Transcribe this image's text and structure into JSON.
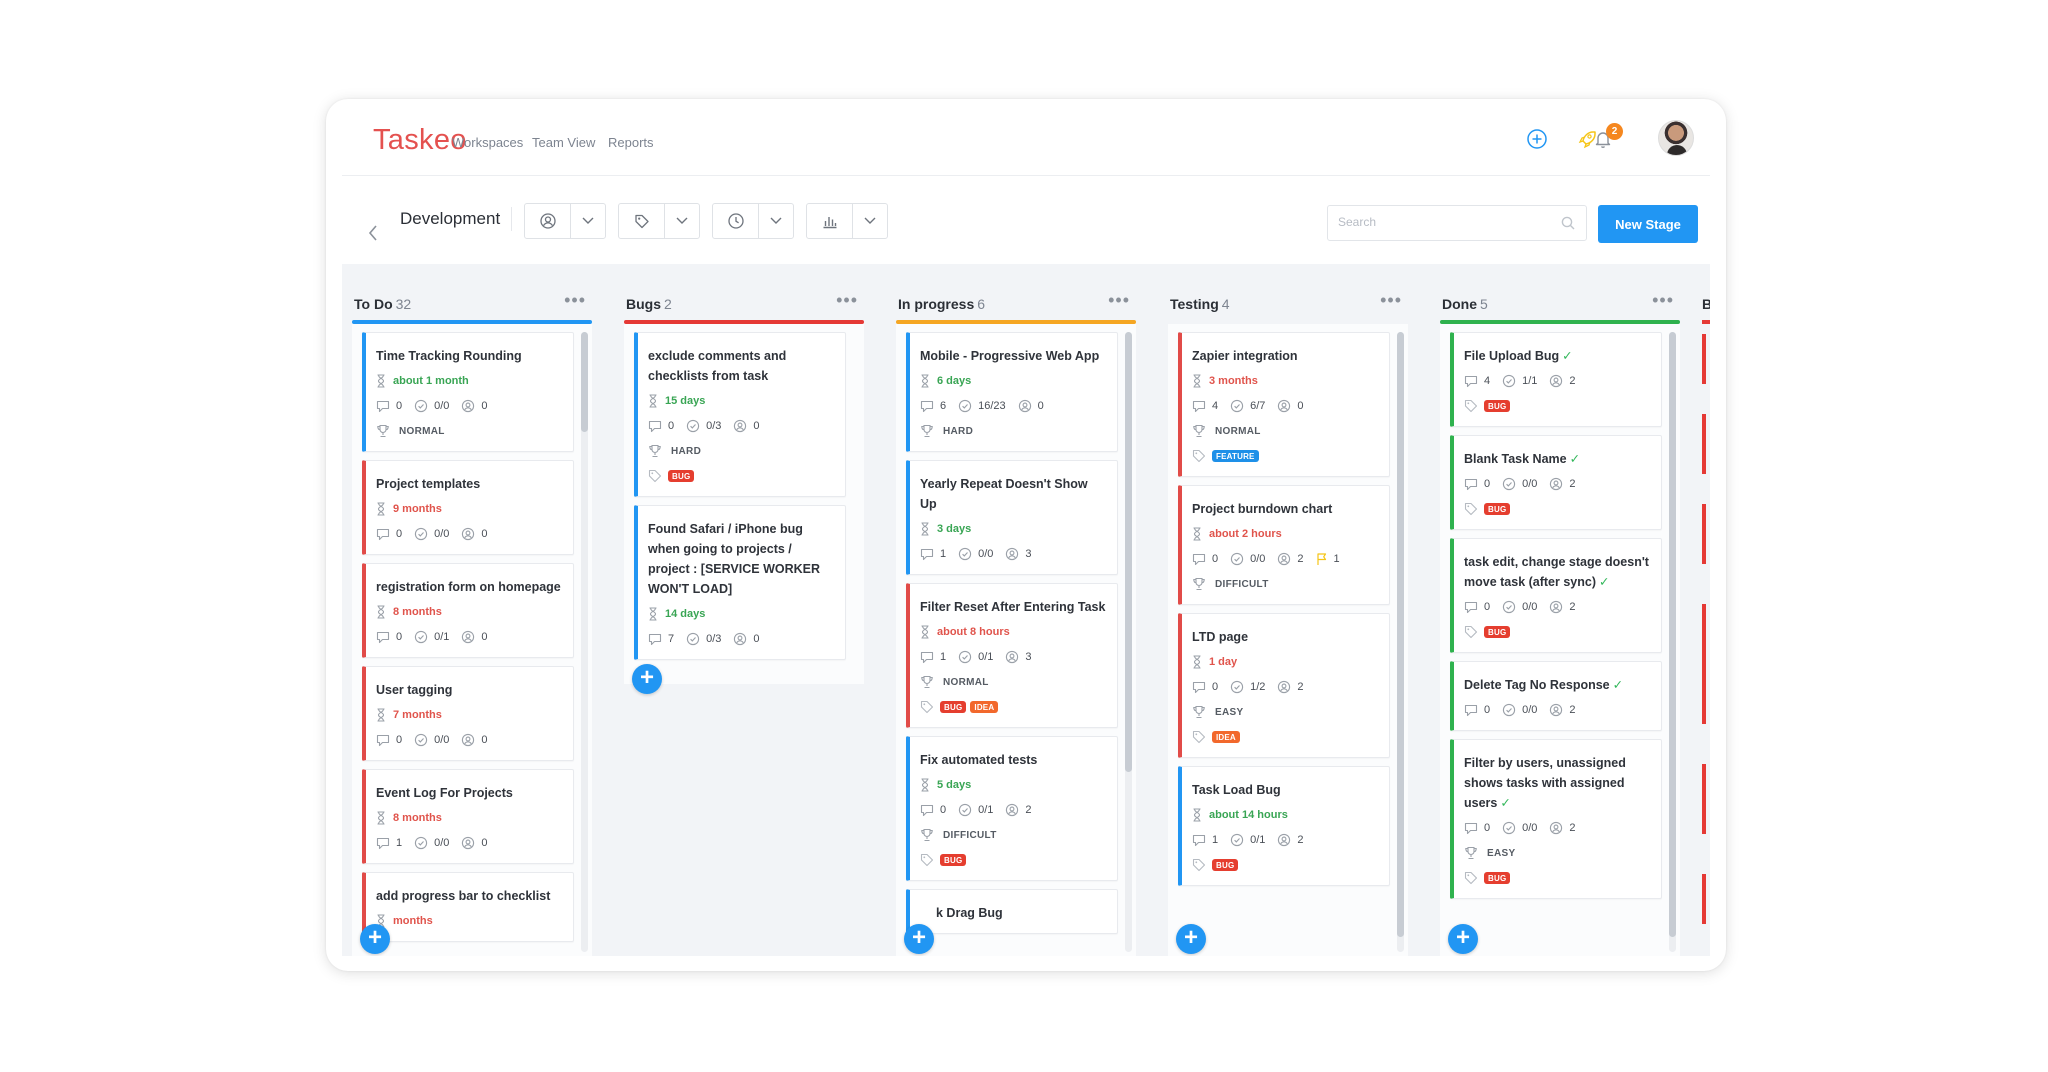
{
  "app": {
    "name": "Taskeo"
  },
  "nav": [
    "Workspaces",
    "Team View",
    "Reports"
  ],
  "notifications": {
    "count": "2"
  },
  "toolbar": {
    "board_title": "Development",
    "search_placeholder": "Search",
    "new_stage_label": "New Stage"
  },
  "colors": {
    "accent": "#2196f3",
    "logo": "#e4514f",
    "bug": "#e53e2f",
    "idea": "#f2682c",
    "feature": "#1e90e8",
    "done_check": "#32b75a"
  },
  "columns": [
    {
      "name": "To Do",
      "count": "32",
      "color": "#2196f3"
    },
    {
      "name": "Bugs",
      "count": "2",
      "color": "#e53935"
    },
    {
      "name": "In progress",
      "count": "6",
      "color": "#f5a623"
    },
    {
      "name": "Testing",
      "count": "4",
      "color": "#f2f4f7"
    },
    {
      "name": "Done",
      "count": "5",
      "color": "#2fb24e"
    },
    {
      "name": "Ba",
      "count": "",
      "color": "#e53935"
    }
  ],
  "todo": [
    {
      "title": "Time Tracking Rounding",
      "due": "about 1 month",
      "comments": "0",
      "checklist": "0/0",
      "users": "0",
      "difficulty": "NORMAL"
    },
    {
      "title": "Project templates",
      "due": "9 months",
      "comments": "0",
      "checklist": "0/0",
      "users": "0"
    },
    {
      "title": "registration form on homepage",
      "due": "8 months",
      "comments": "0",
      "checklist": "0/1",
      "users": "0"
    },
    {
      "title": "User tagging",
      "due": "7 months",
      "comments": "0",
      "checklist": "0/0",
      "users": "0"
    },
    {
      "title": "Event Log For Projects",
      "due": "8 months",
      "comments": "1",
      "checklist": "0/0",
      "users": "0"
    },
    {
      "title": "add progress bar to checklist",
      "due": "months"
    }
  ],
  "bugs": [
    {
      "title": "exclude comments and checklists from task",
      "due": "15 days",
      "comments": "0",
      "checklist": "0/3",
      "users": "0",
      "difficulty": "HARD",
      "tags": [
        "BUG"
      ]
    },
    {
      "title": "Found Safari / iPhone bug when going to projects / project : [SERVICE WORKER WON'T LOAD]",
      "due": "14 days",
      "comments": "7",
      "checklist": "0/3",
      "users": "0"
    }
  ],
  "in_progress": [
    {
      "title": "Mobile - Progressive Web App",
      "due": "6 days",
      "comments": "6",
      "checklist": "16/23",
      "users": "0",
      "difficulty": "HARD"
    },
    {
      "title": "Yearly Repeat Doesn't Show Up",
      "due": "3 days",
      "comments": "1",
      "checklist": "0/0",
      "users": "3"
    },
    {
      "title": "Filter Reset After Entering Task",
      "due": "about 8 hours",
      "comments": "1",
      "checklist": "0/1",
      "users": "3",
      "difficulty": "NORMAL",
      "tags": [
        "BUG",
        "IDEA"
      ]
    },
    {
      "title": "Fix automated tests",
      "due": "5 days",
      "comments": "0",
      "checklist": "0/1",
      "users": "2",
      "difficulty": "DIFFICULT",
      "tags": [
        "BUG"
      ]
    },
    {
      "title": "k Drag Bug"
    }
  ],
  "testing": [
    {
      "title": "Zapier integration",
      "due": "3 months",
      "comments": "4",
      "checklist": "6/7",
      "users": "0",
      "difficulty": "NORMAL",
      "tags": [
        "FEATURE"
      ]
    },
    {
      "title": "Project burndown chart",
      "due": "about 2 hours",
      "comments": "0",
      "checklist": "0/0",
      "users": "2",
      "flags": "1",
      "difficulty": "DIFFICULT"
    },
    {
      "title": "LTD page",
      "due": "1 day",
      "comments": "0",
      "checklist": "1/2",
      "users": "2",
      "difficulty": "EASY",
      "tags": [
        "IDEA"
      ]
    },
    {
      "title": "Task Load Bug",
      "due": "about 14 hours",
      "comments": "1",
      "checklist": "0/1",
      "users": "2",
      "tags": [
        "BUG"
      ]
    }
  ],
  "done": [
    {
      "title": "File Upload Bug",
      "comments": "4",
      "checklist": "1/1",
      "users": "2",
      "tags": [
        "BUG"
      ]
    },
    {
      "title": "Blank Task Name",
      "comments": "0",
      "checklist": "0/0",
      "users": "2",
      "tags": [
        "BUG"
      ]
    },
    {
      "title": "task edit, change stage doesn't move task (after sync)",
      "comments": "0",
      "checklist": "0/0",
      "users": "2",
      "tags": [
        "BUG"
      ]
    },
    {
      "title": "Delete Tag No Response",
      "comments": "0",
      "checklist": "0/0",
      "users": "2"
    },
    {
      "title": "Filter by users, unassigned shows tasks with assigned users",
      "comments": "0",
      "checklist": "0/0",
      "users": "2",
      "difficulty": "EASY",
      "tags": [
        "BUG"
      ]
    }
  ]
}
